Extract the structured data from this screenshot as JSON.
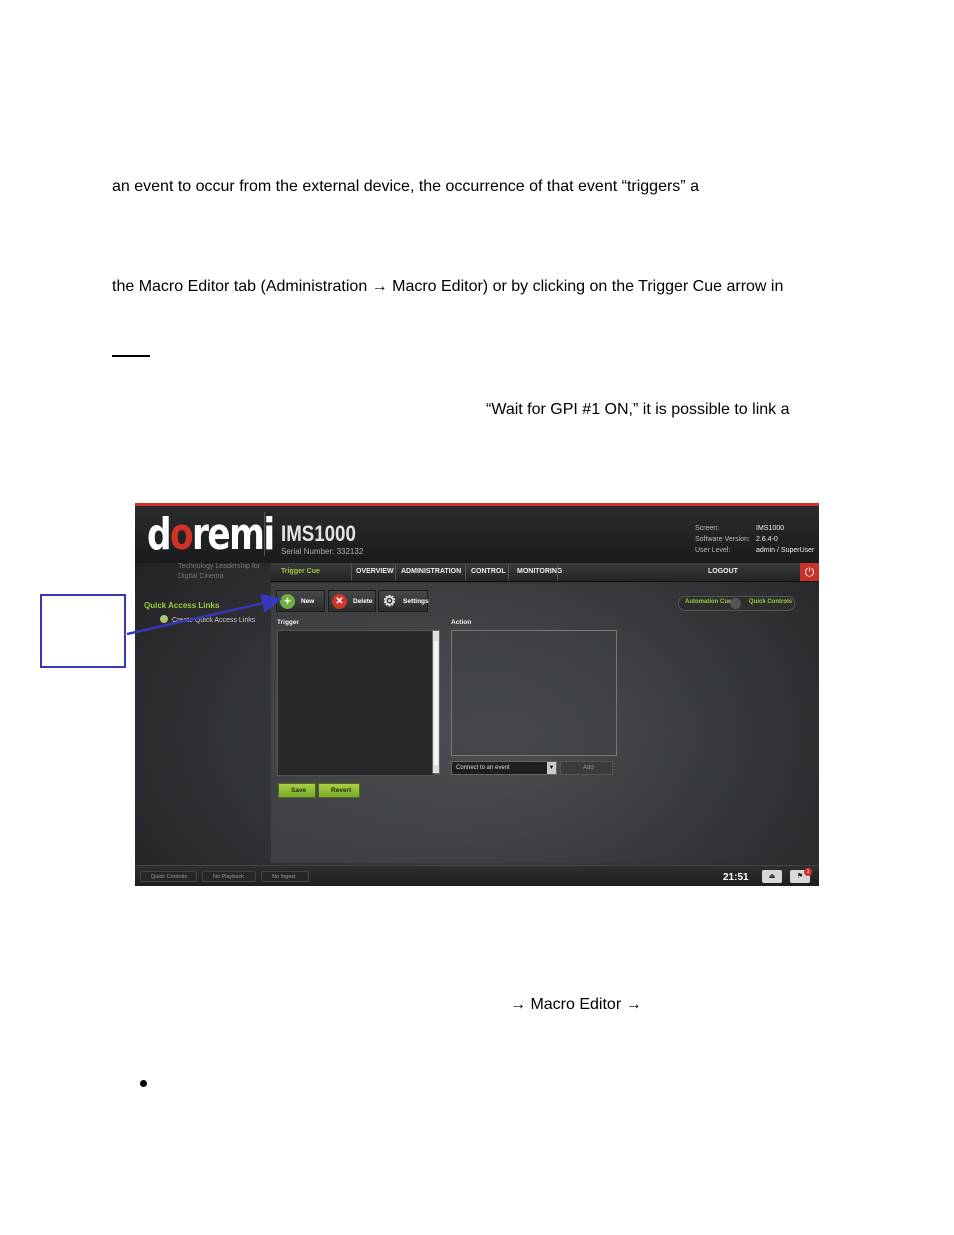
{
  "document": {
    "line1": "an event to occur from the external device, the occurrence of that event “triggers” a",
    "line2": "the Macro Editor tab (Administration → Macro Editor) or by clicking on the Trigger Cue arrow in",
    "line3": "“Wait for GPI #1 ON,” it is possible to link a",
    "line4": "→ Macro Editor →"
  },
  "screenshot": {
    "logo": {
      "d": "d",
      "o": "o",
      "rest": "remi"
    },
    "tagline": "Technology Leadership for Digital Cinema",
    "model": "IMS1000",
    "serial": "Serial Number: 332132",
    "info": {
      "screen_label": "Screen:",
      "screen_value": "IMS1000",
      "software_label": "Software Version:",
      "software_value": "2.6.4-0",
      "user_label": "User Level:",
      "user_value": "admin / SuperUser"
    },
    "nav": {
      "trigger_cue": "Trigger Cue",
      "overview": "OVERVIEW",
      "administration": "ADMINISTRATION",
      "control": "CONTROL",
      "monitoring": "MONITORING",
      "logout": "LOGOUT"
    },
    "sidebar": {
      "quick_access_links": "Quick Access Links",
      "create_quick_access_links": "Create Quick Access Links"
    },
    "toolbar": {
      "new": "New",
      "delete": "Delete",
      "settings": "Settings"
    },
    "toggle": {
      "automation_cue": "Automation Cue",
      "quick_controls": "Quick Controls"
    },
    "columns": {
      "trigger": "Trigger",
      "action": "Action"
    },
    "event_select": "Connect to an event",
    "add": "Add",
    "save": "Save",
    "revert": "Revert",
    "bottom": {
      "quick_controls": "Quick Controls",
      "no_playback": "No Playback",
      "no_ingest": "No Ingest",
      "clock": "21:51",
      "badge": "1"
    }
  }
}
